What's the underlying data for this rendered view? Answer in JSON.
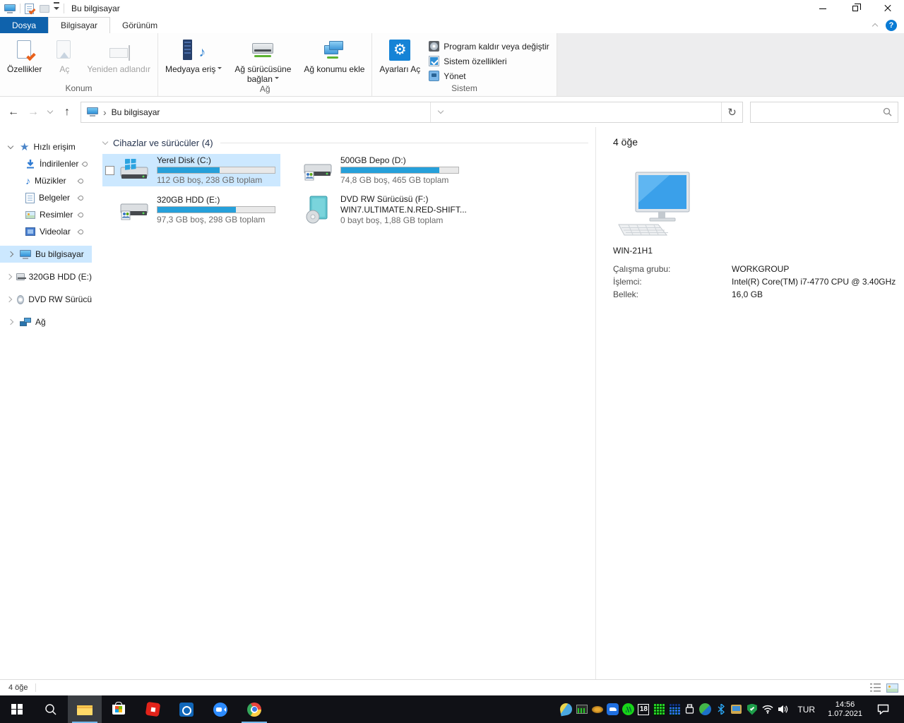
{
  "icons": {
    "gear": "⚙",
    "music_note": "♪",
    "star": "★",
    "crumb_sep": "›",
    "back": "←",
    "forward": "→",
    "up": "↑",
    "refresh": "↻",
    "help": "?"
  },
  "titlebar": {
    "title": "Bu bilgisayar"
  },
  "tabs": {
    "file": "Dosya",
    "computer": "Bilgisayar",
    "view": "Görünüm"
  },
  "ribbon": {
    "konum": {
      "label": "Konum",
      "properties": "Özellikler",
      "open": "Aç",
      "rename": "Yeniden adlandır"
    },
    "ag": {
      "label": "Ağ",
      "access_media": "Medyaya eriş",
      "map_drive": "Ağ sürücüsüne bağlan",
      "add_location": "Ağ konumu ekle"
    },
    "sistem": {
      "label": "Sistem",
      "open_settings": "Ayarları Aç",
      "uninstall": "Program kaldır veya değiştir",
      "system_props": "Sistem özellikleri",
      "manage": "Yönet"
    }
  },
  "addressbar": {
    "location": "Bu bilgisayar"
  },
  "sidebar": {
    "quick_access": "Hızlı erişim",
    "items": [
      {
        "label": "İndirilenler"
      },
      {
        "label": "Müzikler"
      },
      {
        "label": "Belgeler"
      },
      {
        "label": "Resimler"
      },
      {
        "label": "Videolar"
      }
    ],
    "roots": [
      {
        "label": "Bu bilgisayar"
      },
      {
        "label": "320GB HDD (E:)"
      },
      {
        "label": "DVD RW Sürücü"
      },
      {
        "label": "Ağ"
      }
    ]
  },
  "content": {
    "group_header": "Cihazlar ve sürücüler (4)",
    "drives": [
      {
        "name": "Yerel Disk (C:)",
        "info": "112 GB boş, 238 GB toplam",
        "used_pct": 53
      },
      {
        "name": "500GB Depo (D:)",
        "info": "74,8 GB boş, 465 GB toplam",
        "used_pct": 84
      },
      {
        "name": "320GB HDD (E:)",
        "info": "97,3 GB boş, 298 GB toplam",
        "used_pct": 67
      },
      {
        "name": "DVD RW Sürücüsü (F:)",
        "volume": "WIN7.ULTIMATE.N.RED-SHIFT...",
        "info": "0 bayt boş, 1,88 GB toplam"
      }
    ]
  },
  "details": {
    "count": "4 öğe",
    "computer_name": "WIN-21H1",
    "rows": [
      {
        "key": "Çalışma grubu:",
        "value": "WORKGROUP"
      },
      {
        "key": "İşlemci:",
        "value": "Intel(R) Core(TM) i7-4770 CPU @ 3.40GHz"
      },
      {
        "key": "Bellek:",
        "value": "16,0 GB"
      }
    ]
  },
  "statusbar": {
    "count": "4 öğe"
  },
  "taskbar": {
    "language": "TUR",
    "time": "14:56",
    "date": "1.07.2021",
    "calendar_day": "18"
  },
  "colors": {
    "accent": "#0f62ac",
    "selection": "#cce8ff",
    "bar_fill": "#26a0da",
    "taskbar_bg": "#101116"
  }
}
